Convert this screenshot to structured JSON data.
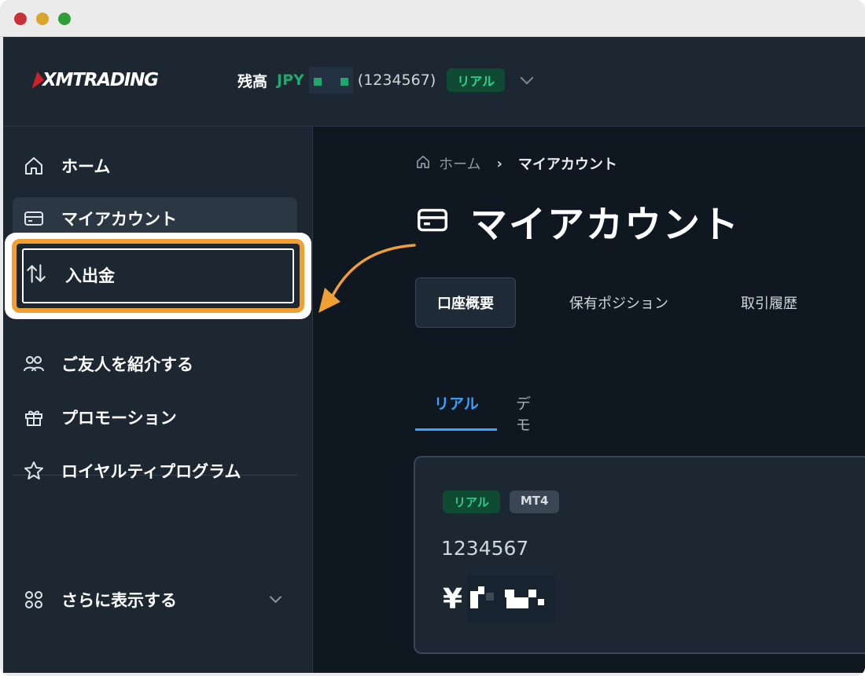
{
  "header": {
    "logo_text": "XMTRADING",
    "balance_label": "残高",
    "currency": "JPY",
    "account_paren": "(1234567)",
    "account_type_badge": "リアル"
  },
  "sidebar": {
    "items": [
      {
        "label": "ホーム",
        "icon": "home-icon"
      },
      {
        "label": "マイアカウント",
        "icon": "card-icon"
      },
      {
        "label": "入出金",
        "icon": "transfer-arrows-icon"
      },
      {
        "label": "ご友人を紹介する",
        "icon": "users-icon"
      },
      {
        "label": "プロモーション",
        "icon": "gift-icon"
      },
      {
        "label": "ロイヤルティプログラム",
        "icon": "star-icon"
      }
    ],
    "more": {
      "label": "さらに表示する",
      "icon": "grid-icon"
    }
  },
  "breadcrumb": {
    "home": "ホーム",
    "current": "マイアカウント"
  },
  "page_title": "マイアカウント",
  "tabs": [
    {
      "label": "口座概要"
    },
    {
      "label": "保有ポジション"
    },
    {
      "label": "取引履歴"
    }
  ],
  "mode_tabs": {
    "real": "リアル",
    "demo": "デモ"
  },
  "account_card": {
    "type_tag": "リアル",
    "platform_tag": "MT4",
    "account_number": "1234567",
    "currency_symbol": "¥"
  },
  "colors": {
    "accent_green": "#1fa86a",
    "highlight_orange": "#f0a032",
    "tab_active_blue": "#3aa3ff",
    "background": "#0f1720",
    "panel": "#1c2731"
  }
}
